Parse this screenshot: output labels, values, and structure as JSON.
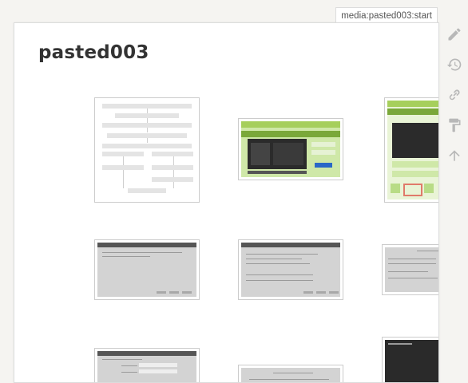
{
  "page": {
    "id_tab": "media:pasted003:start",
    "title": "pasted003"
  },
  "toolbar": {
    "items": [
      "edit",
      "old-revisions",
      "backlinks",
      "manage-subscriptions",
      "back-to-top"
    ]
  },
  "colors": {
    "background": "#f5f4f1",
    "page": "#ffffff",
    "icon": "#b8b8b8",
    "title": "#333333"
  },
  "thumbnails": [
    {
      "id": "flowchart"
    },
    {
      "id": "green-website-banner"
    },
    {
      "id": "green-website-tall"
    },
    {
      "id": "gray-dialog-1"
    },
    {
      "id": "gray-dialog-2"
    },
    {
      "id": "gray-dialog-3"
    },
    {
      "id": "form-dialog"
    },
    {
      "id": "gray-dialog-4"
    },
    {
      "id": "dark-window"
    }
  ]
}
